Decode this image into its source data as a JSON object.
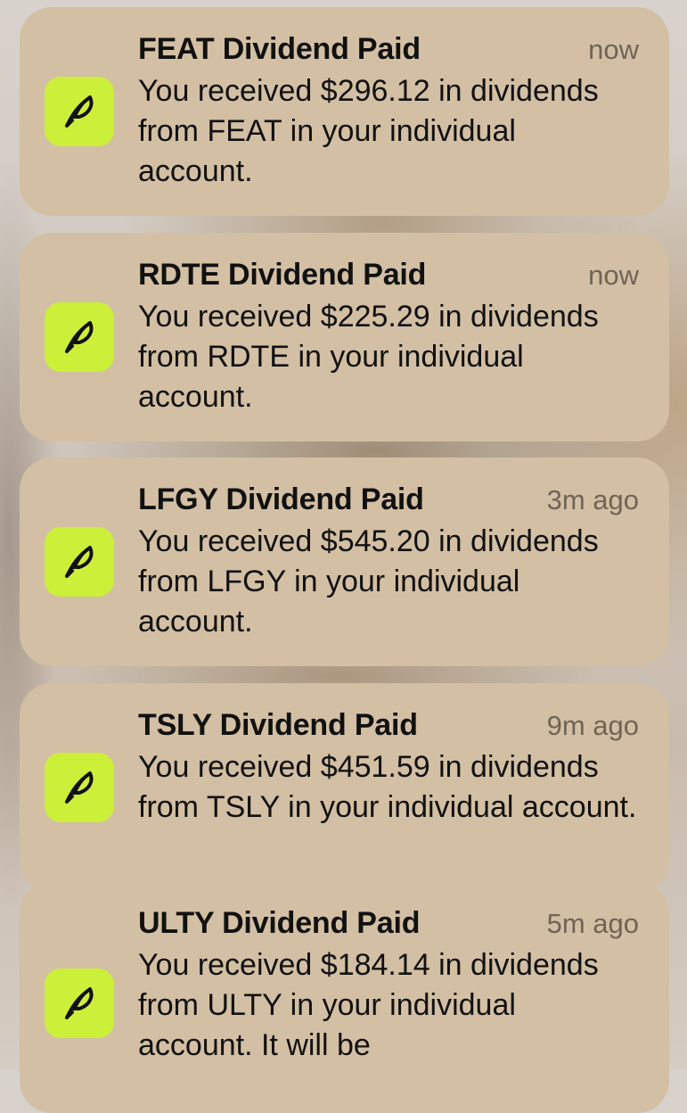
{
  "app": {
    "icon_name": "robinhood-feather-icon",
    "icon_color": "#ccf03a",
    "card_color": "#d3bfa3"
  },
  "notifications": [
    {
      "title": "FEAT Dividend Paid",
      "time": "now",
      "body": "You received $296.12 in dividends from FEAT in your individual account."
    },
    {
      "title": "RDTE Dividend Paid",
      "time": "now",
      "body": "You received $225.29 in dividends from RDTE in your individual account."
    },
    {
      "title": "LFGY Dividend Paid",
      "time": "3m ago",
      "body": "You received $545.20 in dividends from LFGY in your individual account."
    },
    {
      "title": "TSLY Dividend Paid",
      "time": "9m ago",
      "body": "You received $451.59 in dividends from TSLY in your individual account."
    },
    {
      "title": "ULTY Dividend Paid",
      "time": "5m ago",
      "body": "You received $184.14 in dividends from ULTY in your individual account. It will be"
    }
  ]
}
